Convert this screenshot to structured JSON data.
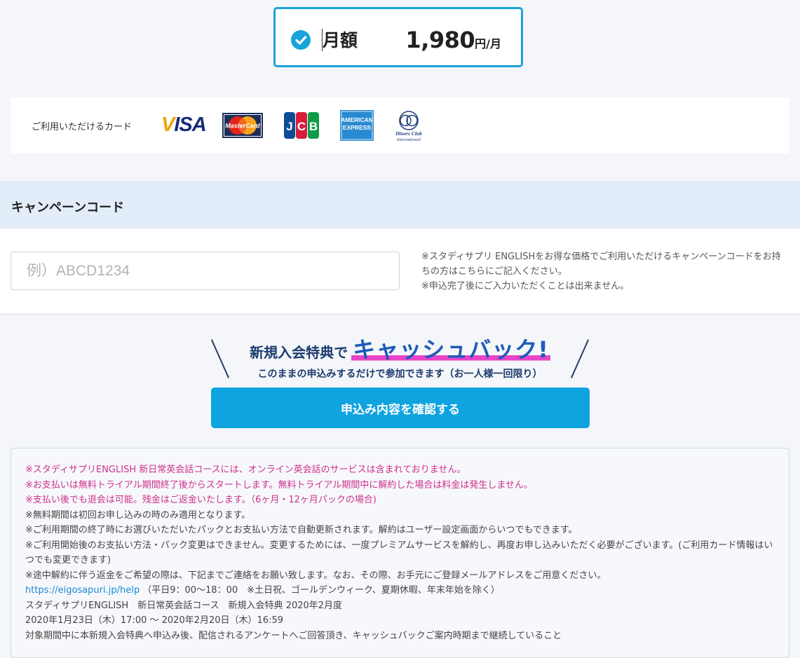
{
  "plan": {
    "name": "月額",
    "price": "1,980",
    "unit": "円/月"
  },
  "cards": {
    "label": "ご利用いただけるカード",
    "brands": [
      {
        "name": "VISA",
        "icon": "visa-logo"
      },
      {
        "name": "MasterCard",
        "icon": "mastercard-logo"
      },
      {
        "name": "JCB",
        "icon": "jcb-logo"
      },
      {
        "name": "AMERICAN EXPRESS",
        "icon": "amex-logo"
      },
      {
        "name": "Diners Club International",
        "icon": "diners-logo"
      }
    ]
  },
  "campaign": {
    "title": "キャンペーンコード",
    "placeholder": "例）ABCD1234",
    "value": "",
    "notes": [
      "※スタディサプリ ENGLISHをお得な価格でご利用いただけるキャンペーンコードをお持ちの方はこちらにご記入ください。",
      "※申込完了後にご入力いただくことは出来ません。"
    ]
  },
  "cashback": {
    "prefix": "新規入会特典で",
    "highlight": "キャッシュバック!",
    "sub": "このままの申込みするだけで参加できます（お一人様一回限り）"
  },
  "cta": {
    "label": "申込み内容を確認する"
  },
  "notes": {
    "pink": [
      "※スタディサプリENGLISH 新日常英会話コースには、オンライン英会話のサービスは含まれておりません。",
      "※お支払いは無料トライアル期間終了後からスタートします。無料トライアル期間中に解約した場合は料金は発生しません。",
      "※支払い後でも退会は可能。残金はご返金いたします。（6ヶ月・12ヶ月パックの場合)"
    ],
    "plain": [
      "※無料期間は初回お申し込みの時のみ適用となります。",
      "※ご利用期間の終了時にお選びいただいたパックとお支払い方法で自動更新されます。解約はユーザー設定画面からいつでもできます。",
      "※ご利用開始後のお支払い方法・パック変更はできません。変更するためには、一度プレミアムサービスを解約し、再度お申し込みいただく必要がございます。(ご利用カード情報はいつでも変更できます)",
      "※途中解約に伴う返金をご希望の際は、下記までご連絡をお願い致します。なお、その際、お手元にご登録メールアドレスをご用意ください。"
    ],
    "help_link": "https://eigosapuri.jp/help",
    "help_hours": "（平日9：00〜18：00　※土日祝、ゴールデンウィーク、夏期休暇、年末年始を除く）",
    "campaign_title": "スタディサプリENGLISH　新日常英会話コース　新規入会特典 2020年2月度",
    "campaign_period": "2020年1月23日（木）17:00 〜 2020年2月20日（木）16:59",
    "campaign_condition": "対象期間中に本新規入会特典へ申込み後、配信されるアンケートへご回答頂き、キャッシュバックご案内時期まで継続していること"
  },
  "colors": {
    "accent": "#1aa3d9",
    "cta": "#0fa3e0",
    "pink_note": "#d0308c",
    "navy": "#1d3a6e",
    "highlight": "#e844c7"
  }
}
